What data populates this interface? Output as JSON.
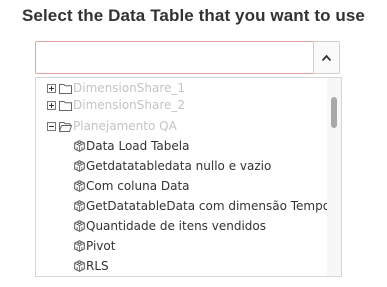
{
  "title": "Select the Data Table that you want to use",
  "select": {
    "value": "",
    "placeholder": "",
    "dropdown_icon": "caret-up-icon"
  },
  "tree": {
    "folders": [
      {
        "label": "DimensionShare_1",
        "state": "collapsed",
        "enabled": false
      },
      {
        "label": "DimensionShare_2",
        "state": "collapsed",
        "enabled": false
      },
      {
        "label": "Planejamento QA",
        "state": "expanded",
        "enabled": false
      }
    ],
    "items": [
      {
        "label": "Data Load Tabela",
        "icon": "cube-icon"
      },
      {
        "label": "Getdatatabledata nullo e vazio",
        "icon": "cube-icon"
      },
      {
        "label": "Com coluna Data",
        "icon": "cube-icon"
      },
      {
        "label": "GetDatatableData com dimensão Tempo",
        "icon": "cube-icon"
      },
      {
        "label": "Quantidade de itens vendidos",
        "icon": "cube-icon"
      },
      {
        "label": "Pivot",
        "icon": "cube-icon"
      },
      {
        "label": "RLS",
        "icon": "cube-icon"
      }
    ]
  },
  "colors": {
    "input_border": "#e3a3a3",
    "disabled_text": "#c4c4c4",
    "text": "#333333"
  }
}
